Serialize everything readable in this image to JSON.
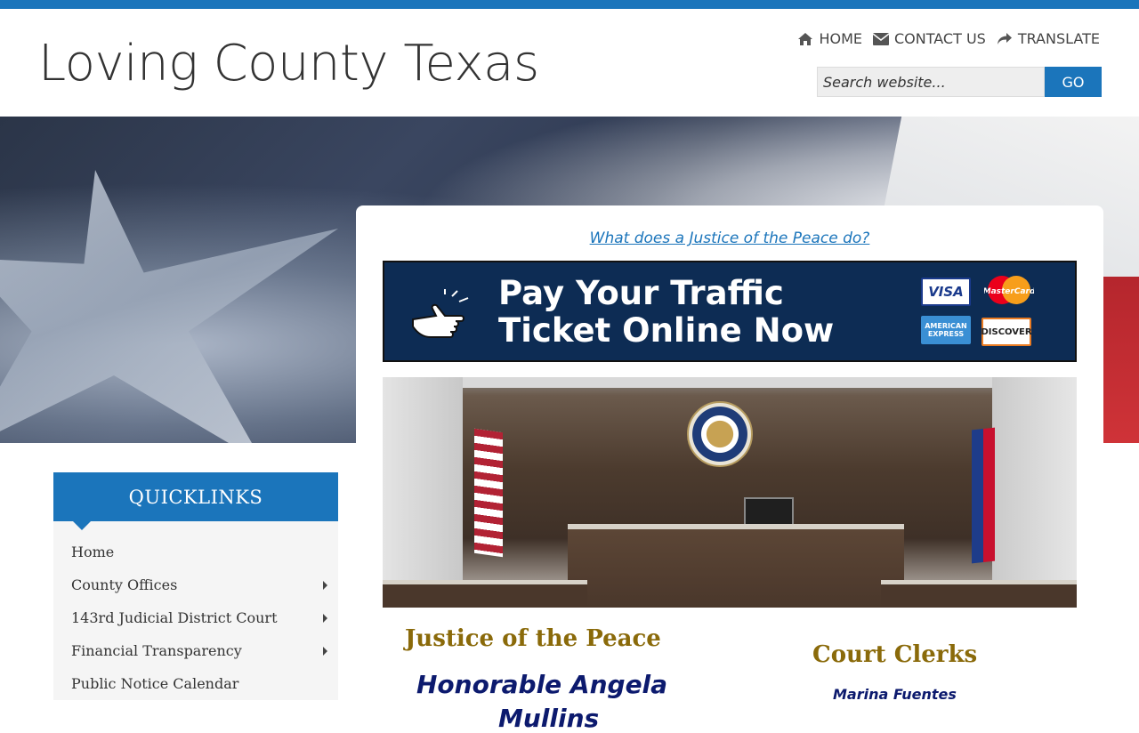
{
  "header": {
    "site_title": "Loving County Texas",
    "nav": [
      {
        "label": "HOME",
        "icon": "home-icon"
      },
      {
        "label": "CONTACT US",
        "icon": "envelope-icon"
      },
      {
        "label": "TRANSLATE",
        "icon": "share-arrow-icon"
      }
    ],
    "search": {
      "placeholder": "Search website...",
      "button_label": "GO"
    }
  },
  "colors": {
    "accent": "#1b75bb",
    "heading_gold": "#8a6a0a",
    "name_navy": "#0c1a6e"
  },
  "quicklinks": {
    "title": "QUICKLINKS",
    "items": [
      {
        "label": "Home",
        "has_submenu": false
      },
      {
        "label": "County Offices",
        "has_submenu": true
      },
      {
        "label": "143rd Judicial District Court",
        "has_submenu": true
      },
      {
        "label": "Financial Transparency",
        "has_submenu": true
      },
      {
        "label": "Public Notice Calendar",
        "has_submenu": false
      }
    ]
  },
  "main": {
    "jp_link": "What does a Justice of the Peace do?",
    "banner": {
      "line1": "Pay Your Traffic",
      "line2": "Ticket Online Now",
      "cards": [
        "VISA",
        "MasterCard",
        "AMERICAN EXPRESS",
        "DISCOVER"
      ]
    },
    "jp_heading": "Justice of the Peace",
    "jp_name_line1": "Honorable Angela",
    "jp_name_line2": "Mullins",
    "clerks_heading": "Court Clerks",
    "clerk_name": "Marina Fuentes"
  }
}
